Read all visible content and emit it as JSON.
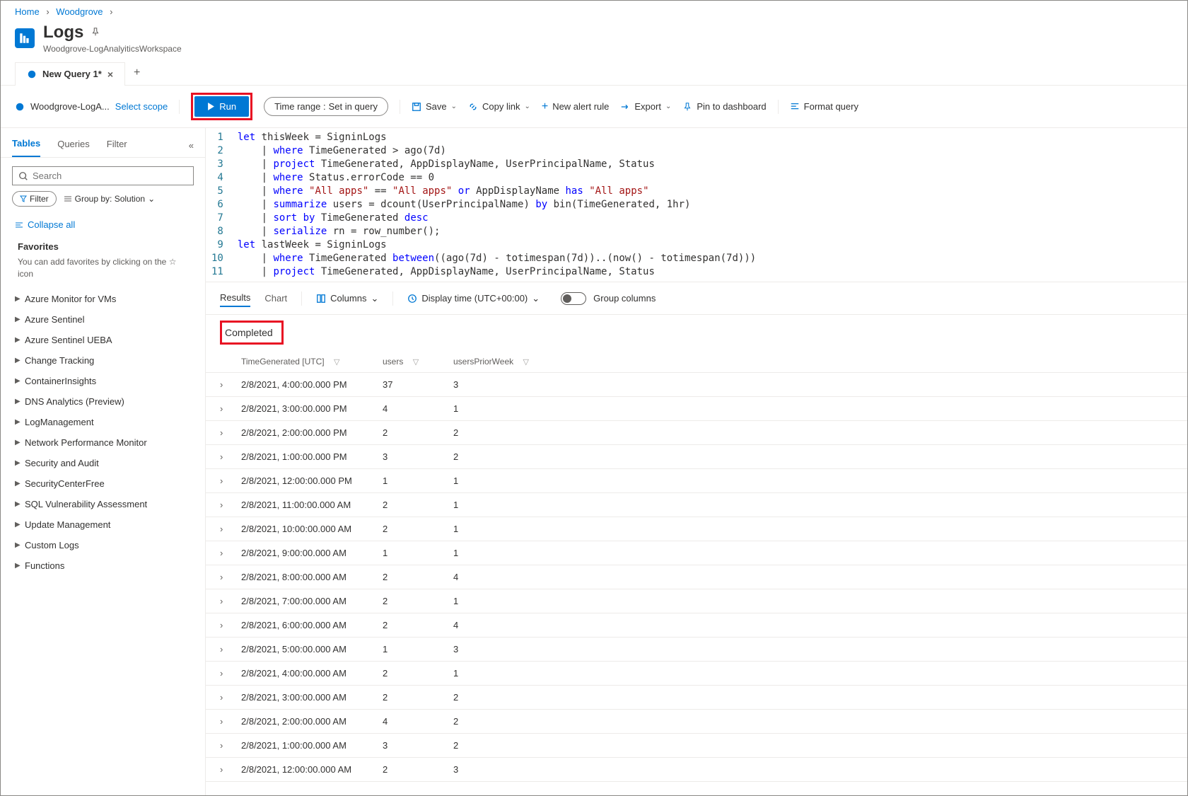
{
  "breadcrumb": {
    "home": "Home",
    "workspace": "Woodgrove"
  },
  "header": {
    "title": "Logs",
    "subtitle": "Woodgrove-LogAnalyiticsWorkspace"
  },
  "tabs": {
    "active": "New Query 1*"
  },
  "toolbar": {
    "scope_label": "Woodgrove-LogA...",
    "select_scope": "Select scope",
    "run": "Run",
    "time_range_label": "Time range :",
    "time_range_value": "Set in query",
    "save": "Save",
    "copy_link": "Copy link",
    "new_alert": "New alert rule",
    "export": "Export",
    "pin": "Pin to dashboard",
    "format": "Format query"
  },
  "sidebar": {
    "tabs": {
      "tables": "Tables",
      "queries": "Queries",
      "filter": "Filter"
    },
    "search_placeholder": "Search",
    "filter_label": "Filter",
    "groupby_label": "Group by: Solution",
    "collapse_all": "Collapse all",
    "favorites_title": "Favorites",
    "favorites_desc": "You can add favorites by clicking on the ☆ icon",
    "tree": [
      "Azure Monitor for VMs",
      "Azure Sentinel",
      "Azure Sentinel UEBA",
      "Change Tracking",
      "ContainerInsights",
      "DNS Analytics (Preview)",
      "LogManagement",
      "Network Performance Monitor",
      "Security and Audit",
      "SecurityCenterFree",
      "SQL Vulnerability Assessment",
      "Update Management",
      "Custom Logs",
      "Functions"
    ]
  },
  "editor_lines": [
    "let thisWeek = SigninLogs",
    "    | where TimeGenerated > ago(7d)",
    "    | project TimeGenerated, AppDisplayName, UserPrincipalName, Status",
    "    | where Status.errorCode == 0",
    "    | where \"All apps\" == \"All apps\" or AppDisplayName has \"All apps\"",
    "    | summarize users = dcount(UserPrincipalName) by bin(TimeGenerated, 1hr)",
    "    | sort by TimeGenerated desc",
    "    | serialize rn = row_number();",
    "let lastWeek = SigninLogs",
    "    | where TimeGenerated between((ago(7d) - totimespan(7d))..(now() - totimespan(7d)))",
    "    | project TimeGenerated, AppDisplayName, UserPrincipalName, Status"
  ],
  "results": {
    "tab_results": "Results",
    "tab_chart": "Chart",
    "columns": "Columns",
    "display_time": "Display time (UTC+00:00)",
    "group_columns": "Group columns",
    "status": "Completed",
    "headers": {
      "time": "TimeGenerated [UTC]",
      "users": "users",
      "prior": "usersPriorWeek"
    },
    "rows": [
      {
        "time": "2/8/2021, 4:00:00.000 PM",
        "users": "37",
        "prior": "3"
      },
      {
        "time": "2/8/2021, 3:00:00.000 PM",
        "users": "4",
        "prior": "1"
      },
      {
        "time": "2/8/2021, 2:00:00.000 PM",
        "users": "2",
        "prior": "2"
      },
      {
        "time": "2/8/2021, 1:00:00.000 PM",
        "users": "3",
        "prior": "2"
      },
      {
        "time": "2/8/2021, 12:00:00.000 PM",
        "users": "1",
        "prior": "1"
      },
      {
        "time": "2/8/2021, 11:00:00.000 AM",
        "users": "2",
        "prior": "1"
      },
      {
        "time": "2/8/2021, 10:00:00.000 AM",
        "users": "2",
        "prior": "1"
      },
      {
        "time": "2/8/2021, 9:00:00.000 AM",
        "users": "1",
        "prior": "1"
      },
      {
        "time": "2/8/2021, 8:00:00.000 AM",
        "users": "2",
        "prior": "4"
      },
      {
        "time": "2/8/2021, 7:00:00.000 AM",
        "users": "2",
        "prior": "1"
      },
      {
        "time": "2/8/2021, 6:00:00.000 AM",
        "users": "2",
        "prior": "4"
      },
      {
        "time": "2/8/2021, 5:00:00.000 AM",
        "users": "1",
        "prior": "3"
      },
      {
        "time": "2/8/2021, 4:00:00.000 AM",
        "users": "2",
        "prior": "1"
      },
      {
        "time": "2/8/2021, 3:00:00.000 AM",
        "users": "2",
        "prior": "2"
      },
      {
        "time": "2/8/2021, 2:00:00.000 AM",
        "users": "4",
        "prior": "2"
      },
      {
        "time": "2/8/2021, 1:00:00.000 AM",
        "users": "3",
        "prior": "2"
      },
      {
        "time": "2/8/2021, 12:00:00.000 AM",
        "users": "2",
        "prior": "3"
      }
    ]
  }
}
